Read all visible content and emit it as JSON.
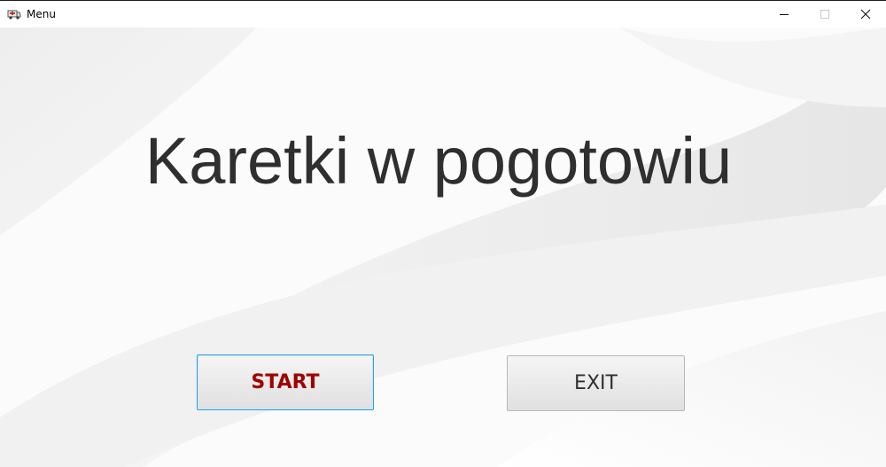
{
  "window": {
    "title": "Menu",
    "icon": "ambulance-icon",
    "controls": {
      "minimize_icon": "minimize-icon",
      "maximize_icon": "maximize-icon",
      "close_icon": "close-icon"
    }
  },
  "main": {
    "heading": "Karetki w pogotowiu",
    "start_label": "START",
    "exit_label": "EXIT"
  },
  "colors": {
    "heading_text": "#2f2f2f",
    "start_text": "#a00000",
    "start_border": "#2a9fe0",
    "exit_text": "#2f2f2f",
    "background": "#ffffff"
  }
}
